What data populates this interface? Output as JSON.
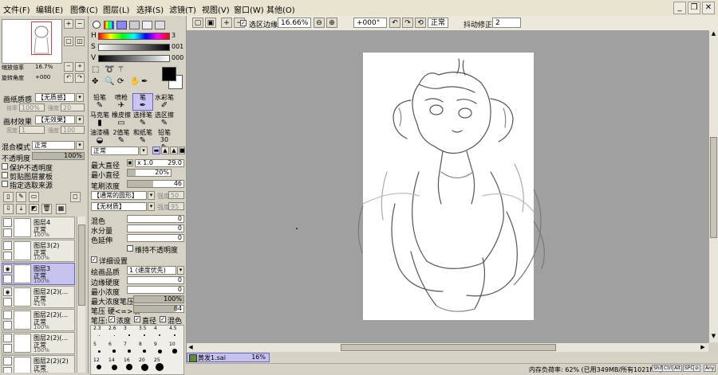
{
  "menu": [
    "文件(F)",
    "编辑(E)",
    "图像(C)",
    "图层(L)",
    "选择(S)",
    "滤镜(T)",
    "视图(V)",
    "窗口(W)",
    "其他(O)"
  ],
  "toolbar": {
    "selection_edge": "选区边缘",
    "zoom": "16.66%",
    "rotation": "+000°",
    "mode": "正常",
    "stabilizer_label": "抖动修正",
    "stabilizer_value": "2"
  },
  "navigator": {
    "zoom_label": "缩放倍率",
    "zoom_value": "16.7%",
    "rotate_label": "旋转角度",
    "rotate_value": "+000"
  },
  "paper_texture": {
    "label": "画纸质感",
    "value": "【无质感】",
    "scale_label": "倍率",
    "scale_value": "100%",
    "strength_label": "强度",
    "strength_value": "20"
  },
  "paper_effect": {
    "label": "画材效果",
    "value": "【无效果】",
    "width_label": "宽度",
    "width_value": "1",
    "strength_label": "强度",
    "strength_value": "100"
  },
  "blend": {
    "label": "混合模式",
    "value": "正常",
    "opacity_label": "不透明度",
    "opacity_value": "100%",
    "opacity_fraction": 1.0
  },
  "layer_options": [
    "保护不透明度",
    "剪贴图层蒙板",
    "指定选取来源"
  ],
  "layers": [
    {
      "name": "图层4",
      "mode": "正常",
      "opacity": "100%",
      "active": false,
      "eye": false
    },
    {
      "name": "图层3(2)",
      "mode": "正常",
      "opacity": "100%",
      "active": false,
      "eye": false
    },
    {
      "name": "图层3",
      "mode": "正常",
      "opacity": "100%",
      "active": true,
      "eye": true
    },
    {
      "name": "图层2(2)(...",
      "mode": "正常",
      "opacity": "41%",
      "active": false,
      "eye": true
    },
    {
      "name": "图层2(2)(...",
      "mode": "正常",
      "opacity": "100%",
      "active": false,
      "eye": false
    },
    {
      "name": "图层2(2)(...",
      "mode": "正常",
      "opacity": "100%",
      "active": false,
      "eye": false
    },
    {
      "name": "图层2(2)(2)",
      "mode": "正常",
      "opacity": "100%",
      "active": false,
      "eye": false
    }
  ],
  "color": {
    "h_label": "H",
    "h_value": "3",
    "s_label": "S",
    "s_value": "001",
    "v_label": "V",
    "v_value": "000",
    "front": "#000000",
    "back": "#ffffff"
  },
  "tools": [
    {
      "name": "铅笔",
      "icon": "✎"
    },
    {
      "name": "喷枪",
      "icon": "✈"
    },
    {
      "name": "笔",
      "icon": "✒"
    },
    {
      "name": "水彩笔",
      "icon": "✐"
    },
    {
      "name": "马克笔",
      "icon": "▮"
    },
    {
      "name": "橡皮擦",
      "icon": "▭"
    },
    {
      "name": "选择笔",
      "icon": "✎"
    },
    {
      "name": "选区擦",
      "icon": "✎"
    },
    {
      "name": "油漆桶",
      "icon": "◒"
    },
    {
      "name": "2值笔",
      "icon": "✎"
    },
    {
      "name": "和纸笔",
      "icon": "✎"
    },
    {
      "name": "铅笔30",
      "icon": "✎"
    }
  ],
  "brush": {
    "mode": "正常",
    "max_size_label": "最大直径",
    "max_size_mult": "x 1.0",
    "max_size_value": "29.0",
    "min_size_label": "最小直径",
    "min_size_value": "20%",
    "density_label": "笔刷浓度",
    "density_value": "46",
    "shape_value": "【通常的圆形】",
    "shape_strength_label": "强度",
    "shape_strength_value": "50",
    "texture_value": "【无材质】",
    "texture_strength_label": "强度",
    "texture_strength_value": "95",
    "blend_label": "混色",
    "blend_value": "0",
    "water_label": "水分量",
    "water_value": "0",
    "persist_label": "色延伸",
    "persist_value": "0",
    "keep_opacity_label": "维持不透明度",
    "detail_label": "详细设置",
    "quality_label": "绘画品质",
    "quality_value": "1 (速度优先)",
    "edge_label": "边缘硬度",
    "edge_value": "0",
    "min_density_label": "最小浓度",
    "min_density_value": "0",
    "max_pressure_label": "最大浓度笔压",
    "max_pressure_value": "100%",
    "pressure_label": "笔压 硬<=>软",
    "pressure_value": "84",
    "pressure_opts_label": "笔压:",
    "opt_density": "浓度",
    "opt_size": "直径",
    "opt_blend": "混色",
    "size_labels_row1": [
      "2.3",
      "2.6",
      "3",
      "3.5",
      "4",
      "4.5"
    ],
    "size_labels_row2": [
      "5",
      "6",
      "7",
      "8",
      "9",
      "10"
    ],
    "size_labels_row3": [
      "12",
      "14",
      "16",
      "20",
      "25"
    ]
  },
  "document": {
    "tab_name": "黄发1.sai",
    "tab_zoom": "16%"
  },
  "status": {
    "memory": "内存负荷率: 62% (已用349MB/所有1021MB)",
    "keys": [
      "Shift",
      "Ctrl",
      "Alt",
      "SPC",
      "⊘",
      "Any"
    ]
  }
}
